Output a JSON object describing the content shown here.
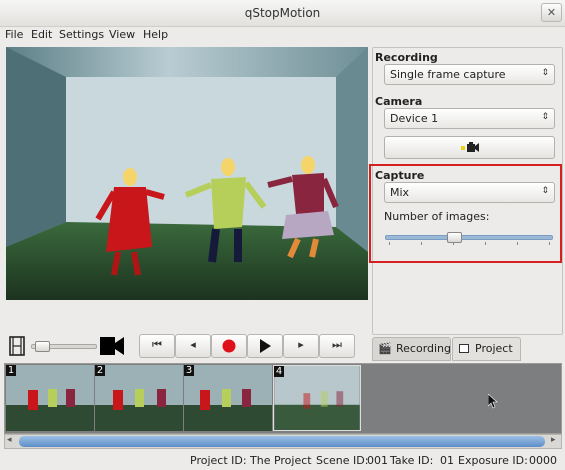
{
  "window": {
    "title": "qStopMotion",
    "close_glyph": "✕"
  },
  "menu": [
    "File",
    "Edit",
    "Settings",
    "View",
    "Help"
  ],
  "recording": {
    "group_label": "Recording",
    "mode_value": "Single frame capture"
  },
  "camera": {
    "group_label": "Camera",
    "device_value": "Device 1",
    "button_icon": "camera-icon"
  },
  "capture": {
    "group_label": "Capture",
    "mode_value": "Mix",
    "images_label": "Number of images:",
    "images_slider_level": 0.3
  },
  "controls": {
    "zoom_slider_level": 0.1,
    "buttons": [
      "rewind-to-start",
      "step-back",
      "record",
      "play",
      "step-forward",
      "jump-to-end"
    ]
  },
  "tabs": [
    {
      "label": "Recording",
      "active": true
    },
    {
      "label": "Project",
      "active": false
    }
  ],
  "thumbnails": [
    {
      "number": "1"
    },
    {
      "number": "2"
    },
    {
      "number": "3"
    },
    {
      "number": "4"
    }
  ],
  "status": {
    "project_id_label": "Project ID:",
    "project_id_value": "The Project",
    "scene_id_label": "Scene ID:",
    "scene_id_value": "001",
    "take_id_label": "Take ID:",
    "take_id_value": "01",
    "exposure_id_label": "Exposure ID:",
    "exposure_id_value": "0000"
  },
  "colors": {
    "record_red": "#e0101a",
    "highlight_red": "#d62020",
    "slider_blue": "#9ab8d8"
  }
}
